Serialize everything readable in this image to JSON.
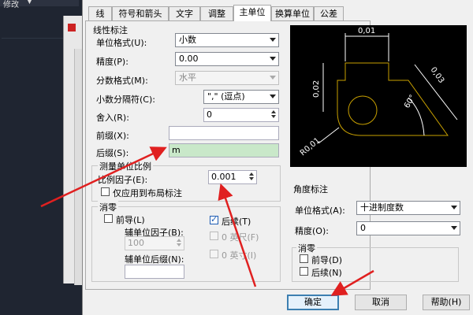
{
  "cad": {
    "menu_modify": "修改",
    "menu_arrow": "▼"
  },
  "tabs": [
    "线",
    "符号和箭头",
    "文字",
    "调整",
    "主单位",
    "换算单位",
    "公差"
  ],
  "linear": {
    "title": "线性标注",
    "unit_format_label": "单位格式(U):",
    "unit_format_value": "小数",
    "precision_label": "精度(P):",
    "precision_value": "0.00",
    "fraction_label": "分数格式(M):",
    "fraction_value": "水平",
    "decimal_sep_label": "小数分隔符(C):",
    "decimal_sep_value": "\",\" (逗点)",
    "round_label": "舍入(R):",
    "round_value": "0",
    "prefix_label": "前缀(X):",
    "prefix_value": "",
    "suffix_label": "后缀(S):",
    "suffix_value": "m"
  },
  "scale": {
    "title": "测量单位比例",
    "factor_label": "比例因子(E):",
    "factor_value": "0.001",
    "layout_only_label": "仅应用到布局标注"
  },
  "zero": {
    "title": "消零",
    "leading_label": "前导(L)",
    "sub_factor_label": "辅单位因子(B):",
    "sub_factor_value": "100",
    "trailing_label": "后续(T)",
    "feet_label": "0 英尺(F)",
    "sub_suffix_label": "辅单位后缀(N):",
    "sub_suffix_value": "",
    "inch_label": "0 英寸(I)"
  },
  "angle": {
    "title": "角度标注",
    "unit_format_label": "单位格式(A):",
    "unit_format_value": "十进制度数",
    "precision_label": "精度(O):",
    "precision_value": "0",
    "zero_title": "消零",
    "leading_label": "前导(D)",
    "trailing_label": "后续(N)"
  },
  "preview": {
    "dim_top": "0,01",
    "dim_left": "0,02",
    "dim_right": "0,03",
    "dim_angle": "60°",
    "dim_radius": "R0,01"
  },
  "buttons": {
    "ok": "确定",
    "cancel": "取消",
    "help": "帮助(H)"
  },
  "colors": {
    "annotation_arrow": "#e02020",
    "preview_bg": "#000000",
    "preview_line": "#c8a000",
    "preview_dim": "#ffffff"
  }
}
